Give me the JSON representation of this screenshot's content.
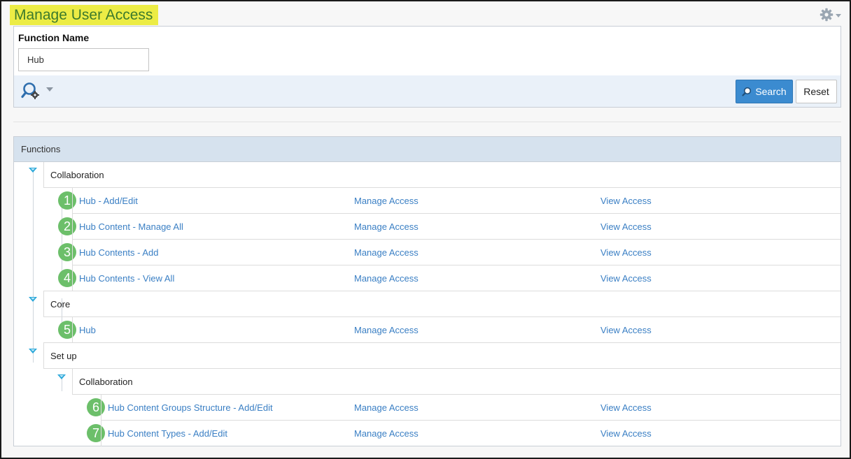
{
  "page": {
    "title": "Manage User Access",
    "settings_icon": "gear-icon"
  },
  "filter": {
    "label": "Function Name",
    "value": "Hub",
    "advanced_search_icon": "search-gear-icon",
    "search_label": "Search",
    "reset_label": "Reset"
  },
  "functions": {
    "header": "Functions",
    "manage_label": "Manage Access",
    "view_label": "View Access",
    "groups": [
      {
        "label": "Collaboration",
        "items": [
          {
            "badge": "1",
            "name": "Hub - Add/Edit"
          },
          {
            "badge": "2",
            "name": "Hub Content - Manage All"
          },
          {
            "badge": "3",
            "name": "Hub Contents - Add"
          },
          {
            "badge": "4",
            "name": "Hub Contents - View All"
          }
        ]
      },
      {
        "label": "Core",
        "items": [
          {
            "badge": "5",
            "name": "Hub"
          }
        ]
      },
      {
        "label": "Set up",
        "subgroups": [
          {
            "label": "Collaboration",
            "items": [
              {
                "badge": "6",
                "name": "Hub Content Groups Structure - Add/Edit"
              },
              {
                "badge": "7",
                "name": "Hub Content Types - Add/Edit"
              }
            ]
          }
        ]
      }
    ]
  },
  "colors": {
    "title_highlight": "#ecec45",
    "title_text": "#3c7a2c",
    "link": "#3a7fc4",
    "badge": "#6cbf6a",
    "search_button": "#3b8bd0",
    "expander": "#29a7d9"
  }
}
